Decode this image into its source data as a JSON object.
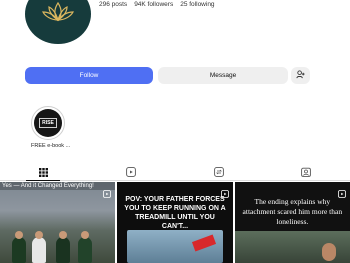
{
  "profile": {
    "avatar_icon": "lotus-logo-icon",
    "stats": {
      "posts": "296 posts",
      "followers": "94K followers",
      "following": "25 following"
    }
  },
  "actions": {
    "follow_label": "Follow",
    "message_label": "Message",
    "add_icon": "add-person-icon"
  },
  "highlights": [
    {
      "label": "FREE e-book ...",
      "cover_text": "RISE"
    }
  ],
  "tabs": [
    {
      "name": "posts-grid",
      "icon": "grid-icon",
      "active": true
    },
    {
      "name": "reels",
      "icon": "reels-icon",
      "active": false
    },
    {
      "name": "reposts",
      "icon": "repost-icon",
      "active": false
    },
    {
      "name": "tagged",
      "icon": "tagged-icon",
      "active": false
    }
  ],
  "posts": [
    {
      "caption": "Yes — And it Changed Everything!",
      "type": "reel"
    },
    {
      "caption": "POV: YOUR FATHER FORCES YOU TO KEEP RUNNING ON A TREADMILL UNTIL YOU CAN'T...",
      "type": "reel"
    },
    {
      "caption": "The ending explains why attachment scared him more than loneliness.",
      "type": "reel"
    }
  ],
  "colors": {
    "accent": "#4f6ff3",
    "button_gray": "#efefef",
    "avatar_bg": "#163b3c",
    "lotus_gold": "#d9b65f"
  }
}
